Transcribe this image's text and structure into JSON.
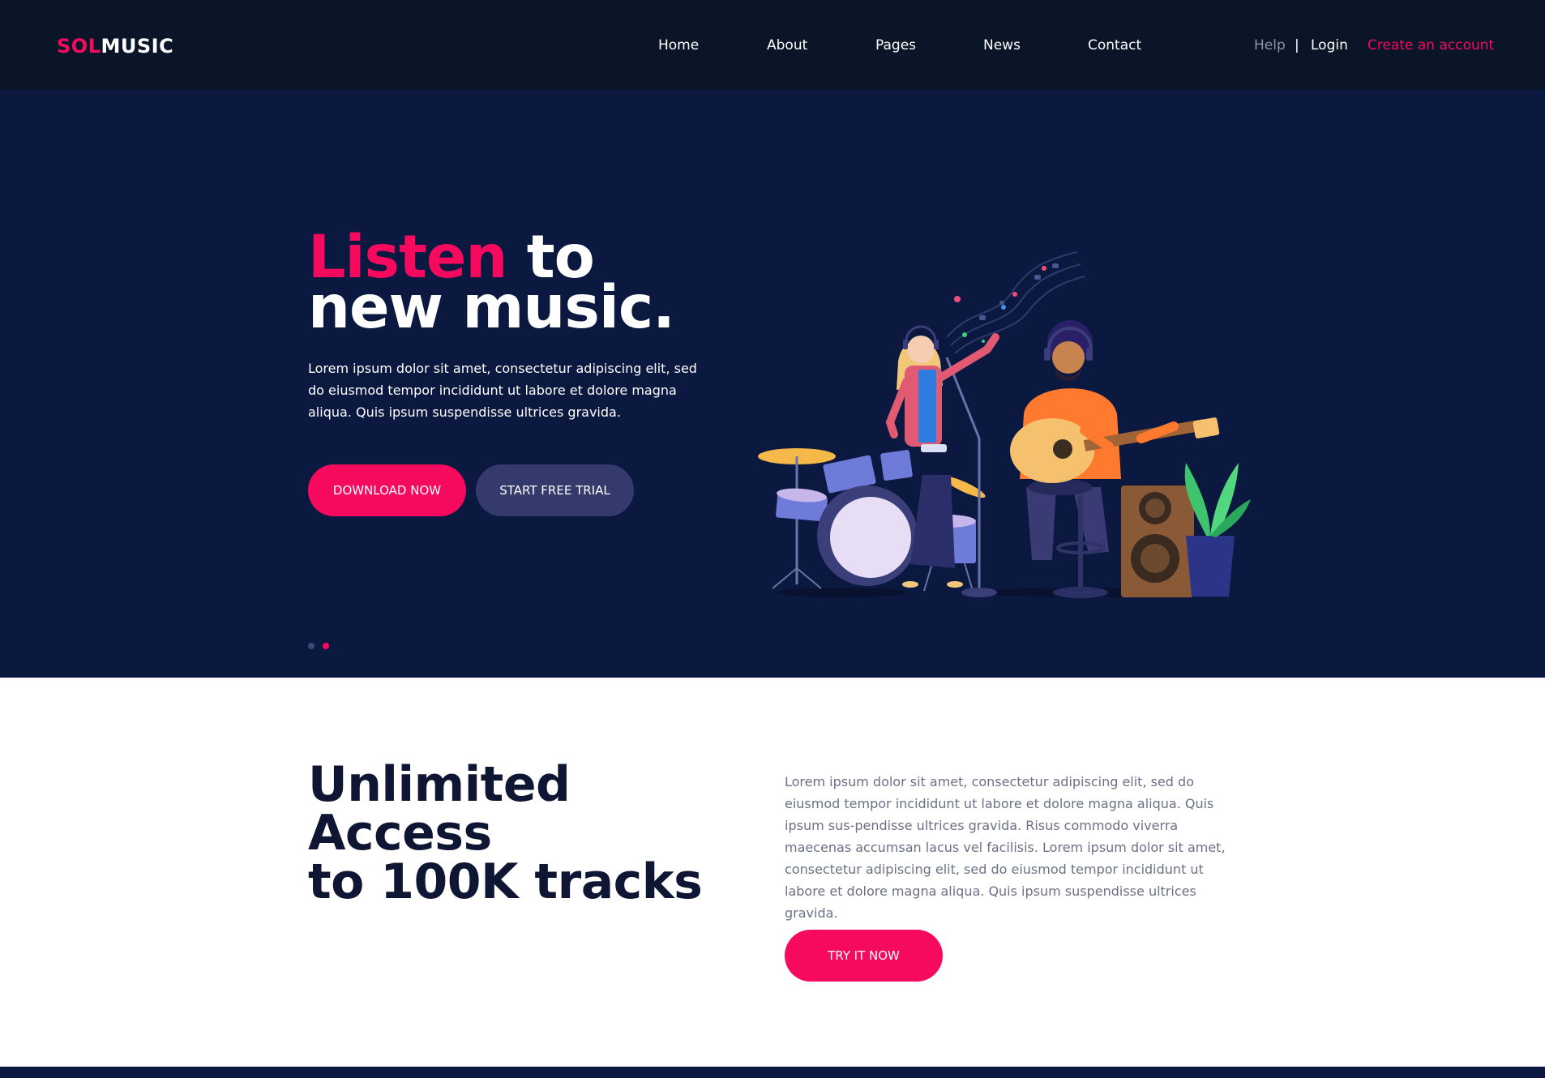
{
  "header": {
    "logo_part1": "SOL",
    "logo_part2": "MUSIC",
    "nav": [
      "Home",
      "About",
      "Pages",
      "News",
      "Contact"
    ],
    "help": "Help",
    "separator": "|",
    "login": "Login",
    "create_account": "Create an account"
  },
  "hero": {
    "title_accent": "Listen",
    "title_rest1": " to",
    "title_line2": "new music.",
    "text": "Lorem ipsum dolor sit amet, consectetur adipiscing elit, sed do eiusmod tempor incididunt ut labore et dolore magna aliqua. Quis ipsum suspendisse ultrices gravida.",
    "download_label": "Download Now",
    "trial_label": "Start free trial",
    "slides_count": 2,
    "active_slide": 2
  },
  "section2": {
    "title_line1": "Unlimited Access",
    "title_line2": "to 100K tracks",
    "text": "Lorem ipsum dolor sit amet, consectetur adipiscing elit, sed do eiusmod tempor incididunt ut labore et dolore magna aliqua. Quis ipsum sus-pendisse ultrices gravida. Risus commodo viverra maecenas accumsan lacus vel facilisis. Lorem ipsum dolor sit amet, consectetur adipiscing elit, sed do eiusmod tempor incididunt ut labore et dolore magna aliqua. Quis ipsum suspendisse ultrices gravida.",
    "button_label": "Try it now"
  },
  "colors": {
    "accent": "#f50a5e",
    "header_bg": "#0a1628",
    "hero_bg": "#0b1840",
    "secondary_button": "#353a6d"
  },
  "icons": [
    "hero-illustration-band"
  ]
}
